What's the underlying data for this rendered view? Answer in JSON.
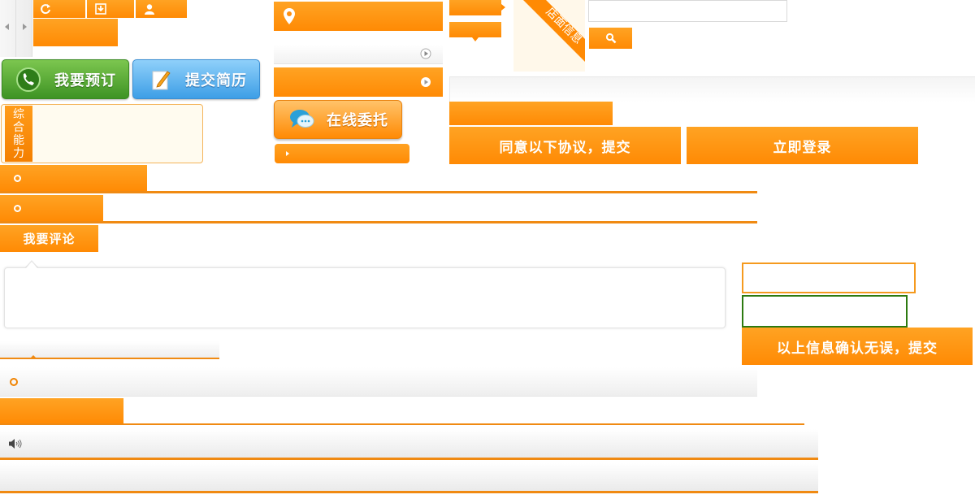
{
  "buttons": {
    "book": "我要预订",
    "resume": "提交简历",
    "entrust": "在线委托",
    "agree_submit": "同意以下协议，提交",
    "login": "立即登录",
    "confirm_submit": "以上信息确认无误，提交"
  },
  "tags": {
    "ability_vertical": [
      "综",
      "合",
      "能",
      "力"
    ],
    "store_info": "店面信息",
    "comment": "我要评论"
  },
  "search": {
    "placeholder": ""
  },
  "colors": {
    "accent": "#ff8a04",
    "accent_dark": "#f08300",
    "green": "#4a9e2a",
    "blue": "#3da0e8",
    "panel": "#fffbef"
  },
  "icons": [
    "refresh-icon",
    "download-icon",
    "user-icon",
    "location-pin-icon",
    "play-circle-icon",
    "phone-icon",
    "edit-icon",
    "chat-icon",
    "search-icon",
    "speaker-icon"
  ]
}
